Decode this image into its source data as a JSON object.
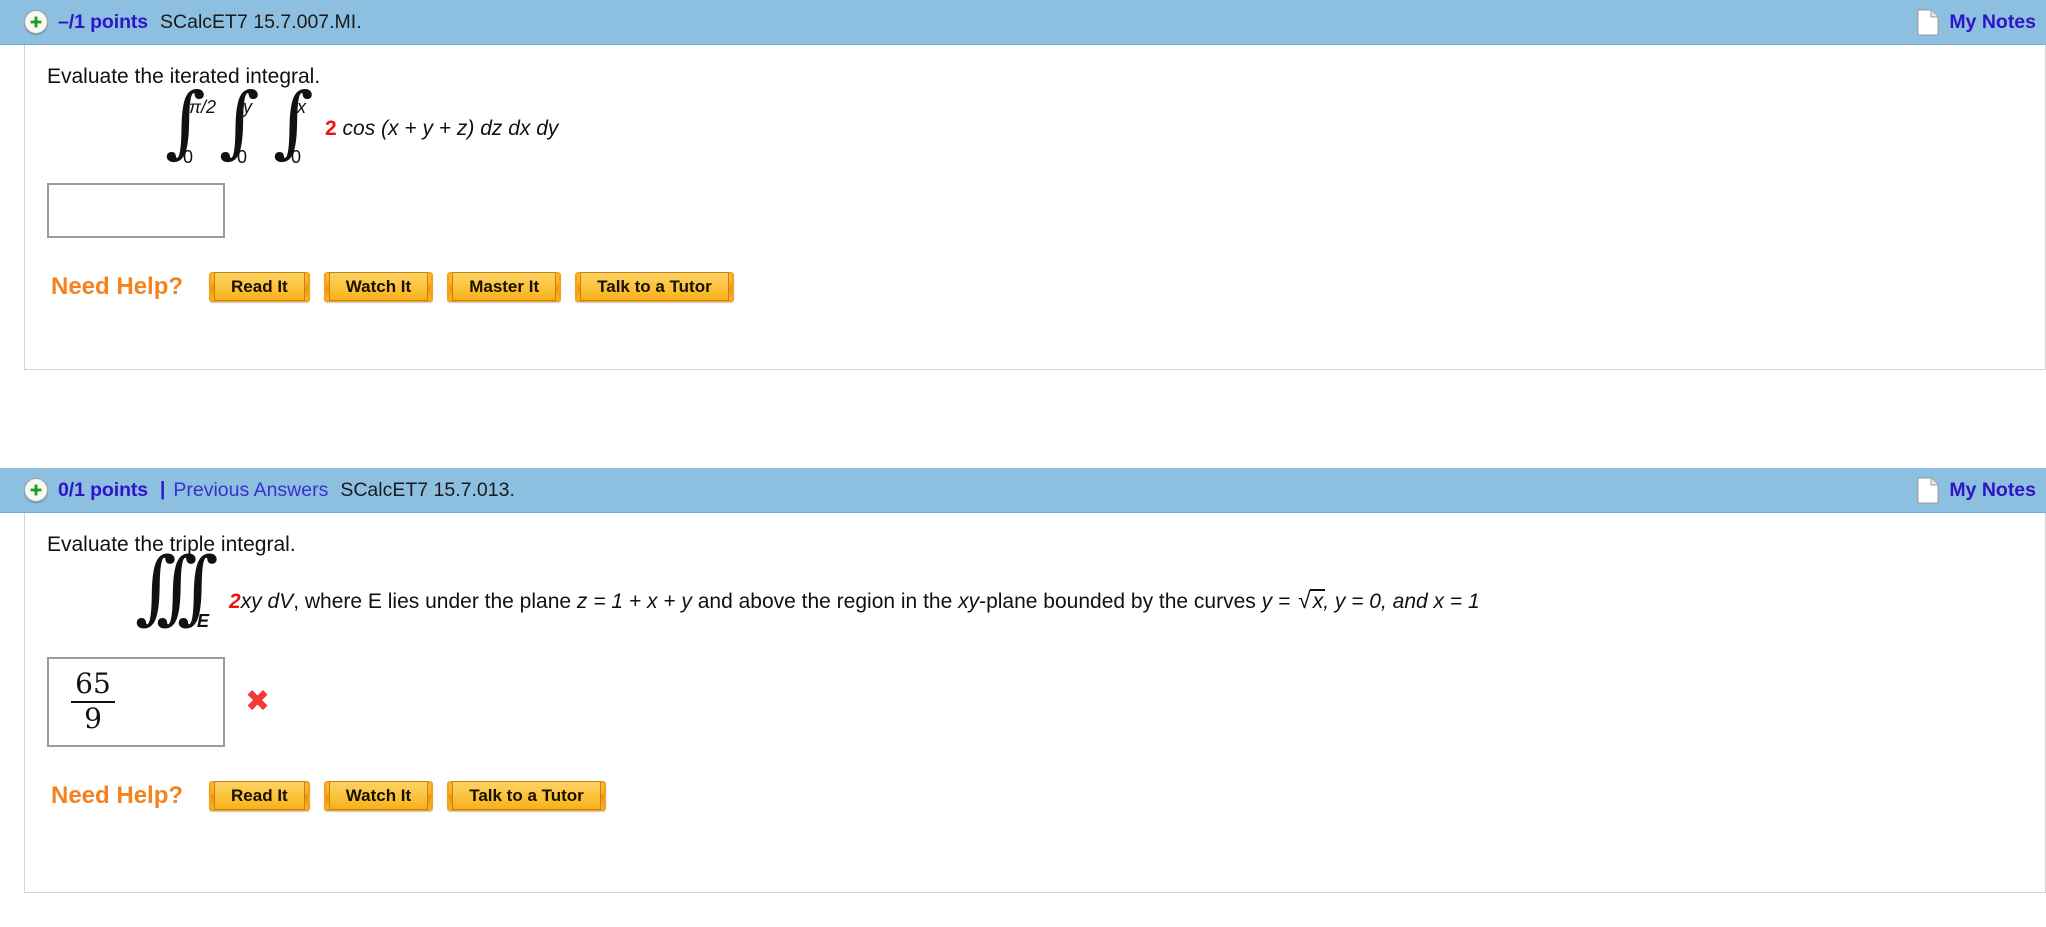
{
  "questions": [
    {
      "points_label": "–/1 points",
      "separator": "|",
      "previous_answers": "",
      "code": "SCalcET7 15.7.007.MI.",
      "my_notes": "My Notes",
      "prompt": "Evaluate the iterated integral.",
      "integral": {
        "limits": [
          {
            "upper": "π/2",
            "lower": "0"
          },
          {
            "upper": "y",
            "lower": "0"
          },
          {
            "upper": "x",
            "lower": "0"
          }
        ],
        "coefficient": "2",
        "body": " cos (x + y + z) dz dx dy"
      },
      "answer": {
        "value": "",
        "status": ""
      },
      "help": {
        "label": "Need Help?",
        "buttons": [
          "Read It",
          "Watch It",
          "Master It",
          "Talk to a Tutor"
        ]
      }
    },
    {
      "points_label": "0/1 points",
      "separator": "|",
      "previous_answers": "Previous Answers",
      "code": "SCalcET7 15.7.013.",
      "my_notes": "My Notes",
      "prompt": "Evaluate the triple integral.",
      "integral": {
        "subscript": "E",
        "coefficient": "2",
        "body_italic": "xy dV",
        "text_1": ", where E lies under the plane ",
        "z_expr": "z = 1 + x + y",
        "text_2": " and above the region in the ",
        "xy": "xy",
        "text_3": "-plane bounded by the curves ",
        "curve_1_lhs": "y = ",
        "sqrt_radicand": "x",
        "curve_rest": ", y = 0, and x = 1"
      },
      "answer": {
        "numerator": "65",
        "denominator": "9",
        "status": "incorrect",
        "status_mark": "✖"
      },
      "help": {
        "label": "Need Help?",
        "buttons": [
          "Read It",
          "Watch It",
          "Talk to a Tutor"
        ]
      }
    }
  ],
  "colors": {
    "header_blue": "#8dbfe0",
    "link_purple": "#3014c8",
    "accent_orange": "#f58220",
    "error_red": "#f23a3a",
    "math_red": "#ee1111"
  }
}
